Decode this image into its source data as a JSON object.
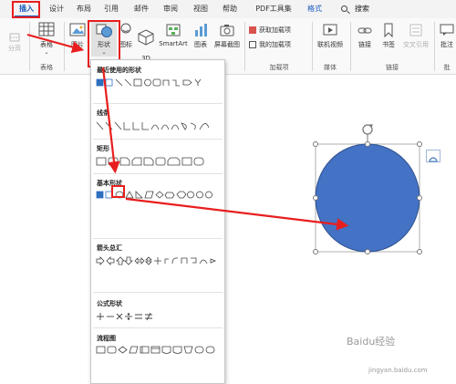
{
  "ribbon_tabs": {
    "insert": "插入",
    "design": "设计",
    "layout": "布局",
    "references": "引用",
    "mailings": "邮件",
    "review": "审阅",
    "view": "视图",
    "help": "帮助",
    "pdf_tools": "PDF工具集",
    "format": "格式",
    "search": "搜索"
  },
  "ribbon": {
    "page_label": "分页",
    "table_label": "表格",
    "picture_label": "图片",
    "shapes_label": "形状",
    "icons_label": "图标",
    "model3d_label": "3D\n模型",
    "smartart_label": "SmartArt",
    "chart_label": "图表",
    "screenshot_label": "屏幕截图",
    "get_addins_label": "获取加载项",
    "my_addins_label": "我的加载项",
    "online_video_label": "联机视频",
    "link_label": "链接",
    "bookmark_label": "书签",
    "crossref_label": "交叉引用",
    "comment_label": "批注",
    "group_tables": "表格",
    "group_addins": "加载项",
    "group_media": "媒体",
    "group_links": "链接",
    "group_comments": "批"
  },
  "gallery": {
    "recent": "最近使用的形状",
    "lines": "线条",
    "rectangles": "矩形",
    "basic": "基本形状",
    "arrows": "箭头总汇",
    "equation": "公式形状",
    "flowchart": "流程图"
  },
  "watermark": {
    "brand": "Baidu经验",
    "url": "jingyan.baidu.com"
  },
  "colors": {
    "accent": "#185abd",
    "shape_fill": "#4472c4",
    "annotation_red": "#e81e1e"
  }
}
